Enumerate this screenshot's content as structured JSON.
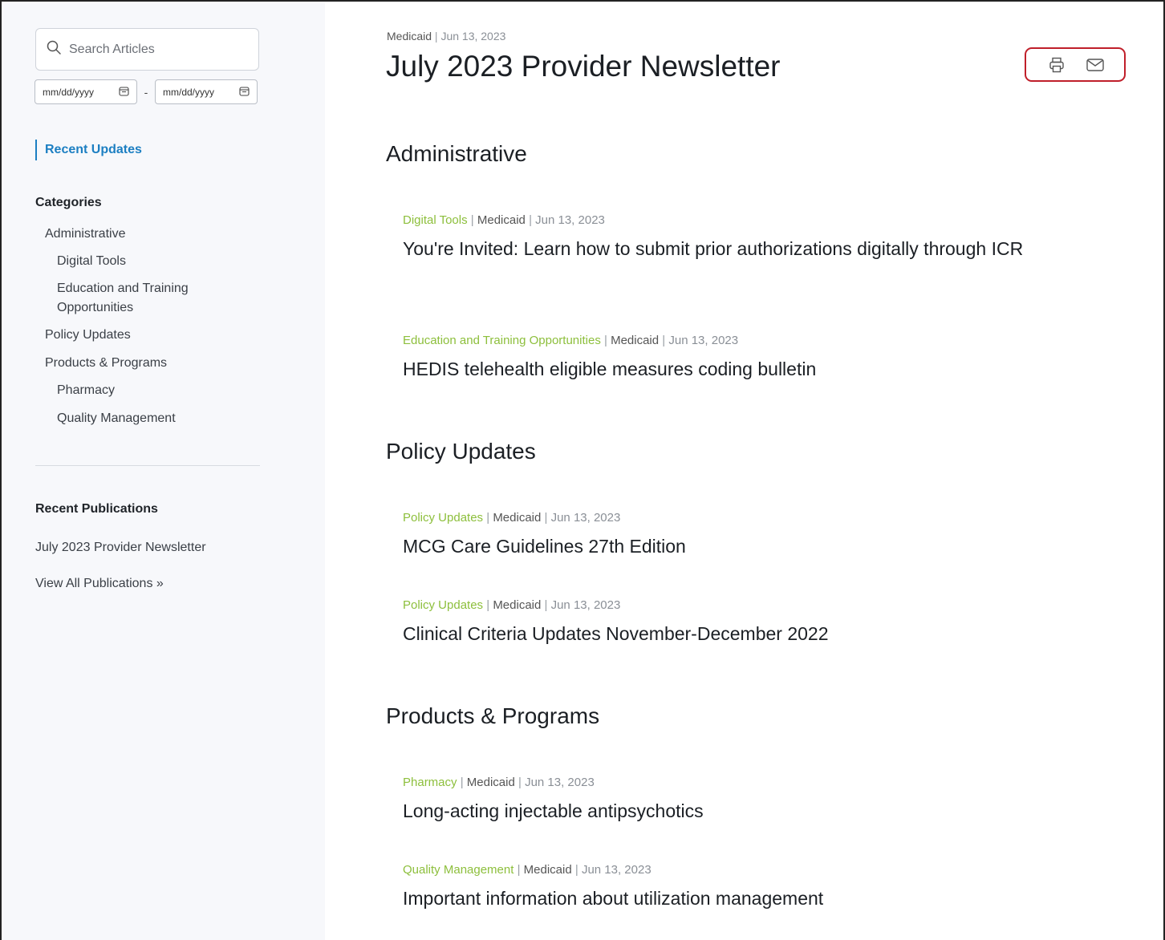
{
  "sidebar": {
    "search": {
      "placeholder": "Search Articles"
    },
    "date_from": {
      "placeholder": "mm/dd/yyyy"
    },
    "date_separator": "-",
    "date_to": {
      "placeholder": "mm/dd/yyyy"
    },
    "recent_updates_label": "Recent Updates",
    "categories_title": "Categories",
    "categories": [
      {
        "label": "Administrative",
        "level": 1
      },
      {
        "label": "Digital Tools",
        "level": 2
      },
      {
        "label": "Education and Training Opportunities",
        "level": 2
      },
      {
        "label": "Policy Updates",
        "level": 1
      },
      {
        "label": "Products & Programs",
        "level": 1
      },
      {
        "label": "Pharmacy",
        "level": 2
      },
      {
        "label": "Quality Management",
        "level": 2
      }
    ],
    "recent_publications_title": "Recent Publications",
    "publications": [
      {
        "label": "July 2023 Provider Newsletter"
      },
      {
        "label": "View All Publications »"
      }
    ]
  },
  "main": {
    "breadcrumb": {
      "category": "Medicaid",
      "separator": "|",
      "date": "Jun 13, 2023"
    },
    "title": "July 2023 Provider Newsletter",
    "actions": {
      "print_icon": "printer-icon",
      "email_icon": "envelope-icon"
    },
    "sections": [
      {
        "title": "Administrative",
        "articles": [
          {
            "tag": "Digital Tools",
            "plan": "Medicaid",
            "date": "Jun 13, 2023",
            "title": "You're Invited: Learn how to submit prior authorizations digitally through ICR"
          },
          {
            "tag": "Education and Training Opportunities",
            "plan": "Medicaid",
            "date": "Jun 13, 2023",
            "title": "HEDIS telehealth eligible measures coding bulletin"
          }
        ]
      },
      {
        "title": "Policy Updates",
        "articles": [
          {
            "tag": "Policy Updates",
            "plan": "Medicaid",
            "date": "Jun 13, 2023",
            "title": "MCG Care Guidelines 27th Edition"
          },
          {
            "tag": "Policy Updates",
            "plan": "Medicaid",
            "date": "Jun 13, 2023",
            "title": "Clinical Criteria Updates November-December 2022"
          }
        ]
      },
      {
        "title": "Products & Programs",
        "articles": [
          {
            "tag": "Pharmacy",
            "plan": "Medicaid",
            "date": "Jun 13, 2023",
            "title": "Long-acting injectable antipsychotics"
          },
          {
            "tag": "Quality Management",
            "plan": "Medicaid",
            "date": "Jun 13, 2023",
            "title": "Important information about utilization management"
          }
        ]
      }
    ]
  },
  "colors": {
    "accent_link": "#1c7fc2",
    "tag_green": "#8dbf3c",
    "highlight_red": "#c01f2a"
  }
}
